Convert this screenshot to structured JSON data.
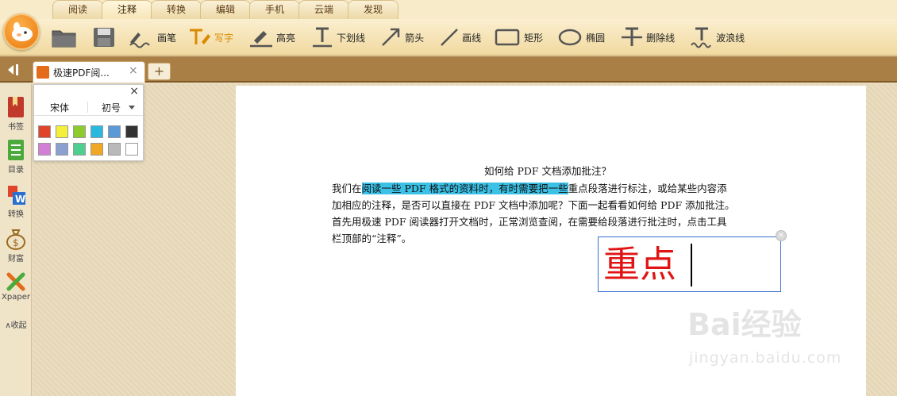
{
  "menu": {
    "tabs": [
      "阅读",
      "注释",
      "转换",
      "编辑",
      "手机",
      "云端",
      "发现"
    ],
    "active": "注释"
  },
  "toolbar": {
    "tools": [
      {
        "icon": "pen-scribble-icon",
        "label": "画笔"
      },
      {
        "icon": "typewriter-icon",
        "label": "写字",
        "active": true
      },
      {
        "icon": "highlighter-icon",
        "label": "高亮"
      },
      {
        "icon": "underline-icon",
        "label": "下划线"
      },
      {
        "icon": "arrow-icon",
        "label": "箭头"
      },
      {
        "icon": "line-icon",
        "label": "画线"
      },
      {
        "icon": "rectangle-icon",
        "label": "矩形"
      },
      {
        "icon": "ellipse-icon",
        "label": "椭圆"
      },
      {
        "icon": "strikethrough-icon",
        "label": "删除线"
      },
      {
        "icon": "wavy-underline-icon",
        "label": "波浪线"
      }
    ]
  },
  "document_tab": {
    "title": "极速PDF阅...",
    "close": "×",
    "add": "+"
  },
  "sidebar": {
    "items": [
      {
        "icon": "bookmark-icon",
        "label": "书签"
      },
      {
        "icon": "outline-icon",
        "label": "目录"
      },
      {
        "icon": "convert-icon",
        "label": "转换"
      },
      {
        "icon": "money-bag-icon",
        "label": "财富"
      },
      {
        "icon": "xpaper-icon",
        "label": "Xpaper"
      }
    ],
    "collapse": "∧收起"
  },
  "font_popover": {
    "close": "×",
    "font_name": "宋体",
    "font_size": "初号",
    "colors": [
      "#e0452c",
      "#f4ef3a",
      "#8ccb2b",
      "#2ab8e0",
      "#5b9ad6",
      "#333333",
      "#d37fd6",
      "#8b9fd0",
      "#4fcf8f",
      "#f0a824",
      "#b9b9b9",
      "#ffffff"
    ]
  },
  "document": {
    "heading": "如何给 PDF 文档添加批注？",
    "line1_pre": "我们在",
    "line1_highlight": "阅读一些 PDF 格式的资料时，有时需要把一些",
    "line1_post": "重点段落进行标注，或给某些内容添",
    "line2": "加相应的注释，是否可以直接在 PDF 文档中添加呢？下面一起看看如何给 PDF 添加批注。",
    "line3": "首先用极速 PDF 阅读器打开文档时，正常浏览查阅，在需要给段落进行批注时，点击工具",
    "line4": "栏顶部的“注释”。"
  },
  "annotation": {
    "text": "重点",
    "close": "×",
    "color": "#e01414"
  },
  "watermark": {
    "text": "Bai经验",
    "sub": "jingyan.baidu.com"
  }
}
